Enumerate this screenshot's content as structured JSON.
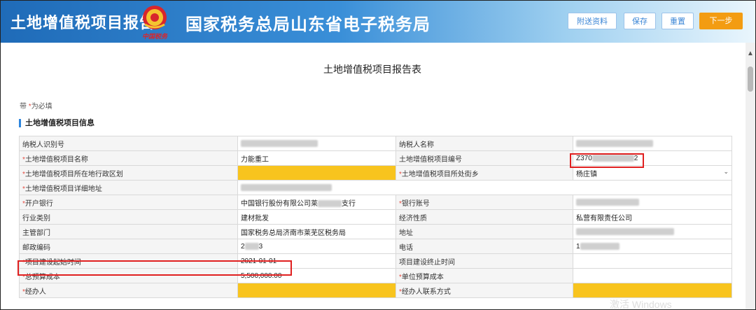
{
  "header": {
    "app_title": "土地增值税项目报告",
    "emblem_caption": "中国税务",
    "bureau_title": "国家税务总局山东省电子税务局",
    "buttons": {
      "attach": "附送资料",
      "save": "保存",
      "reset": "重置",
      "next": "下一步"
    }
  },
  "report": {
    "title": "土地增值税项目报告表",
    "required_prefix": "带",
    "required_star": "*",
    "required_suffix": "为必填",
    "section_title": "土地增值税项目信息"
  },
  "rows": [
    {
      "l1": "纳税人识别号",
      "s1": false,
      "v1": "",
      "l2": "纳税人名称",
      "s2": false,
      "v2": ""
    },
    {
      "l1": "土地增值税项目名称",
      "s1": true,
      "v1": "力能重工",
      "l2": "土地增值税项目编号",
      "s2": false,
      "v2": "Z370",
      "v2b": "2"
    },
    {
      "l1": "土地增值税项目所在地行政区划",
      "s1": true,
      "v1": "",
      "l2": "土地增值税项目所处街乡",
      "s2": true,
      "v2": "杨庄镇"
    },
    {
      "l1": "土地增值税项目详细地址",
      "s1": true,
      "v1": ""
    },
    {
      "l1": "开户银行",
      "s1": true,
      "v1a": "中国银行股份有限公司莱",
      "v1b": "支行",
      "l2": "银行账号",
      "s2": true,
      "v2": ""
    },
    {
      "l1": "行业类别",
      "s1": false,
      "v1": "建材批发",
      "l2": "经济性质",
      "s2": false,
      "v2": "私营有限责任公司"
    },
    {
      "l1": "主管部门",
      "s1": false,
      "v1": "国家税务总局济南市莱芜区税务局",
      "l2": "地址",
      "s2": false,
      "v2": ""
    },
    {
      "l1": "邮政编码",
      "s1": false,
      "v1a": "2",
      "v1b": "3",
      "l2": "电话",
      "s2": false,
      "v2": "1"
    },
    {
      "l1": "项目建设起始时间",
      "s1": true,
      "v1": "2021-01-01",
      "l2": "项目建设终止时间",
      "s2": false,
      "v2": ""
    },
    {
      "l1": "总预算成本",
      "s1": true,
      "v1": "5,500,000.00",
      "l2": "单位预算成本",
      "s2": true,
      "v2": ""
    },
    {
      "l1": "经办人",
      "s1": true,
      "v1": "",
      "l2": "经办人联系方式",
      "s2": true,
      "v2": ""
    }
  ],
  "watermark": "激活 Windows",
  "colors": {
    "header_blue": "#1f6bb8",
    "accent_orange": "#f39c12",
    "required_red": "#e54d42",
    "highlight_yellow": "#f8c41e",
    "annotation_red": "#e02020"
  }
}
